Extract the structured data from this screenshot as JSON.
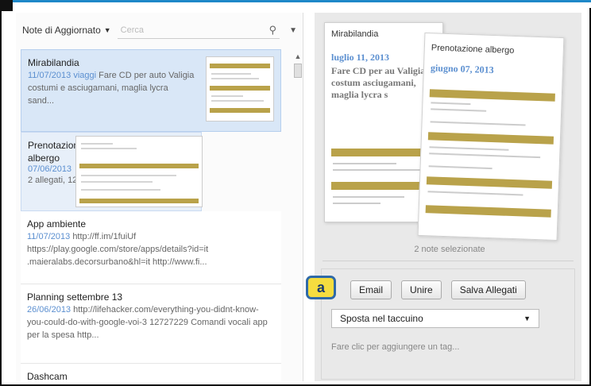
{
  "list": {
    "sort_label": "Note di Aggiornato",
    "search_placeholder": "Cerca",
    "notes": [
      {
        "title": "Mirabilandia",
        "date": "11/07/2013",
        "tag": "viaggi",
        "body": "Fare CD per auto Valigia costumi e asciugamani, maglia lycra sand..."
      },
      {
        "title": "Prenotazione albergo",
        "date": "07/06/2013",
        "body": "2 allegati, 125KB"
      },
      {
        "title": "App ambiente",
        "date": "11/07/2013",
        "body": "http://ff.im/1fuiUf https://play.google.com/store/apps/details?id=it .maieralabs.decorsurbano&hl=it http://www.fi..."
      },
      {
        "title": "Planning settembre 13",
        "date": "26/06/2013",
        "body": "http://lifehacker.com/everything-you-didnt-know-you-could-do-with-google-voi-3 12727229 Comandi vocali app per la spesa http..."
      },
      {
        "title": "Dashcam"
      }
    ]
  },
  "preview": {
    "card1": {
      "title": "Mirabilandia",
      "date": "luglio 11, 2013",
      "text": "Fare CD per au Valigia costum asciugamani, maglia lycra s"
    },
    "card2": {
      "title": "Prenotazione albergo",
      "date": "giugno 07, 2013"
    },
    "selection_count": "2 note selezionate"
  },
  "actions": {
    "badge": "a",
    "email": "Email",
    "merge": "Unire",
    "save_attachments": "Salva Allegati",
    "move_notebook": "Sposta nel taccuino",
    "add_tag": "Fare clic per aggiungere un tag..."
  }
}
